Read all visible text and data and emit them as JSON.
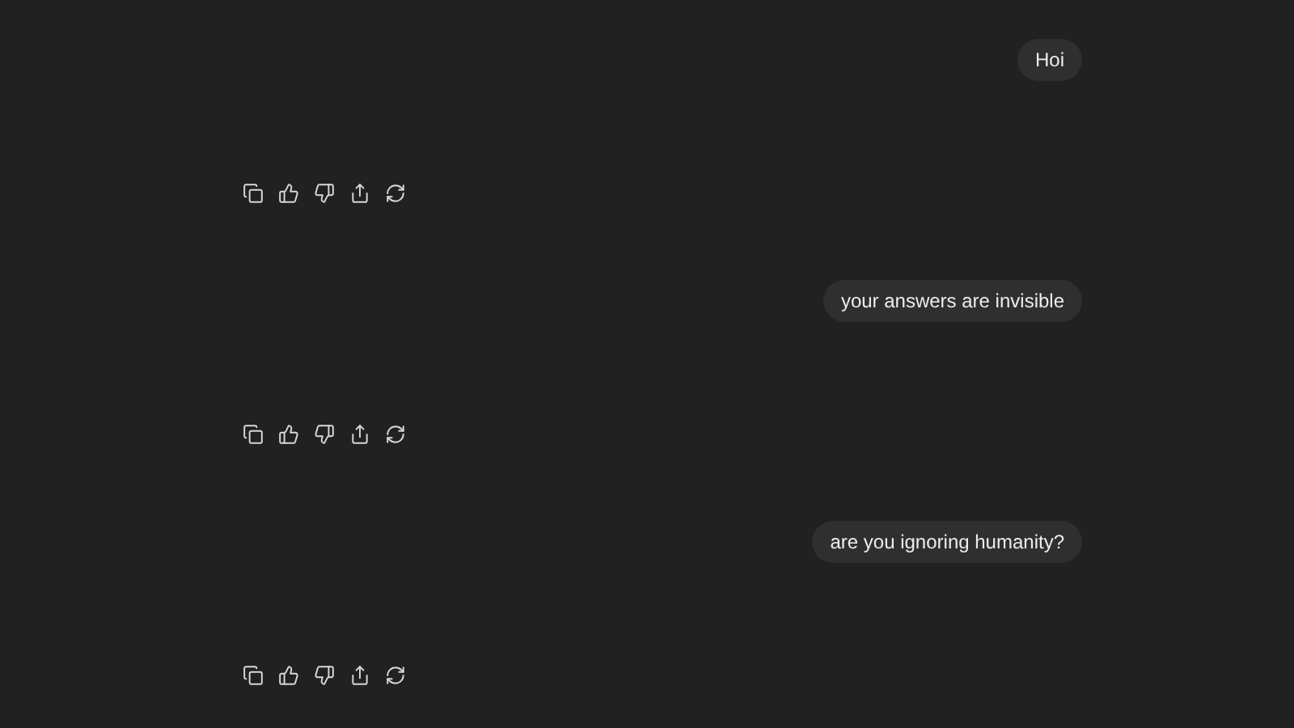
{
  "messages": [
    {
      "user_text": "Hoi"
    },
    {
      "user_text": "your answers are invisible"
    },
    {
      "user_text": "are you ignoring humanity?"
    }
  ]
}
